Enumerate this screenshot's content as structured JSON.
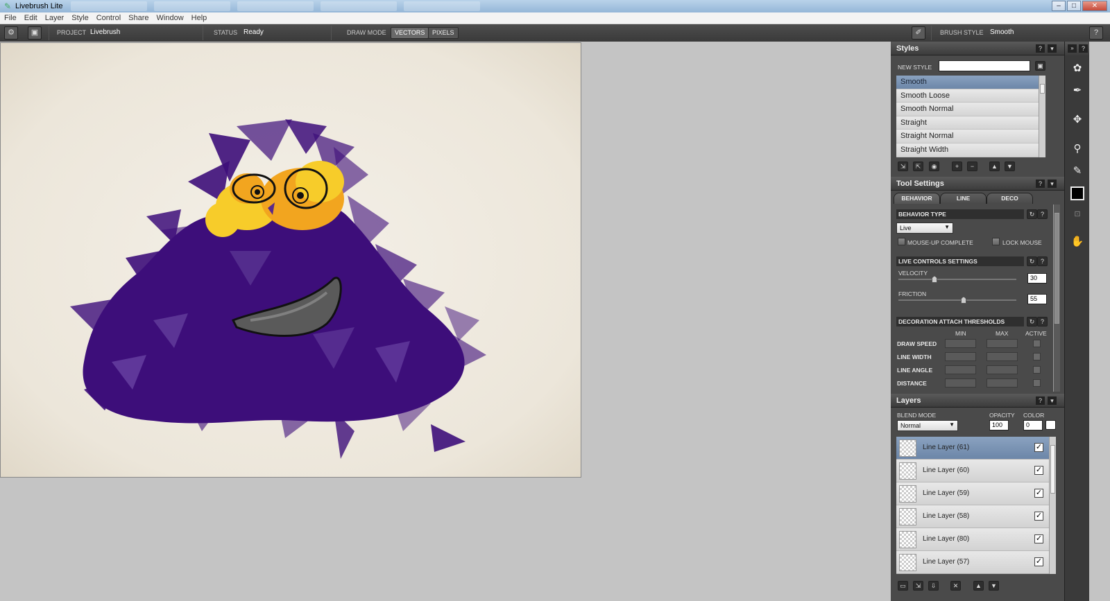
{
  "window": {
    "title": "Livebrush Lite",
    "app_icon": "pencil-icon",
    "min_glyph": "–",
    "max_glyph": "□",
    "close_glyph": "✕"
  },
  "menu": [
    "File",
    "Edit",
    "Layer",
    "Style",
    "Control",
    "Share",
    "Window",
    "Help"
  ],
  "toolbar": {
    "project_label": "PROJECT",
    "project_value": "Livebrush",
    "status_label": "STATUS",
    "status_value": "Ready",
    "draw_mode_label": "DRAW MODE",
    "modes": [
      "VECTORS",
      "PIXELS"
    ],
    "active_mode": "VECTORS",
    "brush_style_label": "BRUSH STYLE",
    "brush_style_value": "Smooth",
    "help_glyph": "?"
  },
  "styles_panel": {
    "title": "Styles",
    "new_style_label": "NEW STYLE",
    "new_style_value": "",
    "items": [
      "Smooth",
      "Smooth Loose",
      "Smooth Normal",
      "Straight",
      "Straight Normal",
      "Straight Width"
    ],
    "selected": "Smooth"
  },
  "tool_settings": {
    "title": "Tool Settings",
    "tabs": [
      "BEHAVIOR",
      "LINE",
      "DECO"
    ],
    "active_tab": "BEHAVIOR",
    "behavior_type_label": "BEHAVIOR TYPE",
    "behavior_type_value": "Live",
    "mouse_up_complete_label": "MOUSE-UP COMPLETE",
    "lock_mouse_label": "LOCK MOUSE",
    "live_controls_label": "LIVE CONTROLS SETTINGS",
    "velocity_label": "VELOCITY",
    "velocity_value": "30",
    "friction_label": "FRICTION",
    "friction_value": "55",
    "deco_thresholds_label": "DECORATION ATTACH THRESHOLDS",
    "col_min": "MIN",
    "col_max": "MAX",
    "col_active": "ACTIVE",
    "threshold_rows": [
      "DRAW SPEED",
      "LINE WIDTH",
      "LINE ANGLE",
      "DISTANCE"
    ]
  },
  "layers_panel": {
    "title": "Layers",
    "blend_mode_label": "BLEND MODE",
    "blend_mode_value": "Normal",
    "opacity_label": "OPACITY",
    "opacity_value": "100",
    "color_label": "COLOR",
    "color_value": "0",
    "layers": [
      "Line Layer (61)",
      "Line Layer (60)",
      "Line Layer (59)",
      "Line Layer (58)",
      "Line Layer (80)",
      "Line Layer (57)"
    ],
    "selected": "Line Layer (61)",
    "check_glyph": "✓"
  },
  "colors": {
    "purple": "#3d0e7a",
    "orange": "#f2a51f",
    "yellow": "#f7cc2a",
    "paper": "#f1ece2"
  },
  "icons": {
    "settings": "gear-icon",
    "save": "save-icon",
    "brush_preview": "brush-icon",
    "tools": [
      "brush-tool-icon",
      "pen-tool-icon",
      "transform-tool-icon",
      "fill-tool-icon",
      "eyedropper-icon",
      "color-swatch",
      "lock-icon",
      "hand-tool-icon"
    ]
  }
}
